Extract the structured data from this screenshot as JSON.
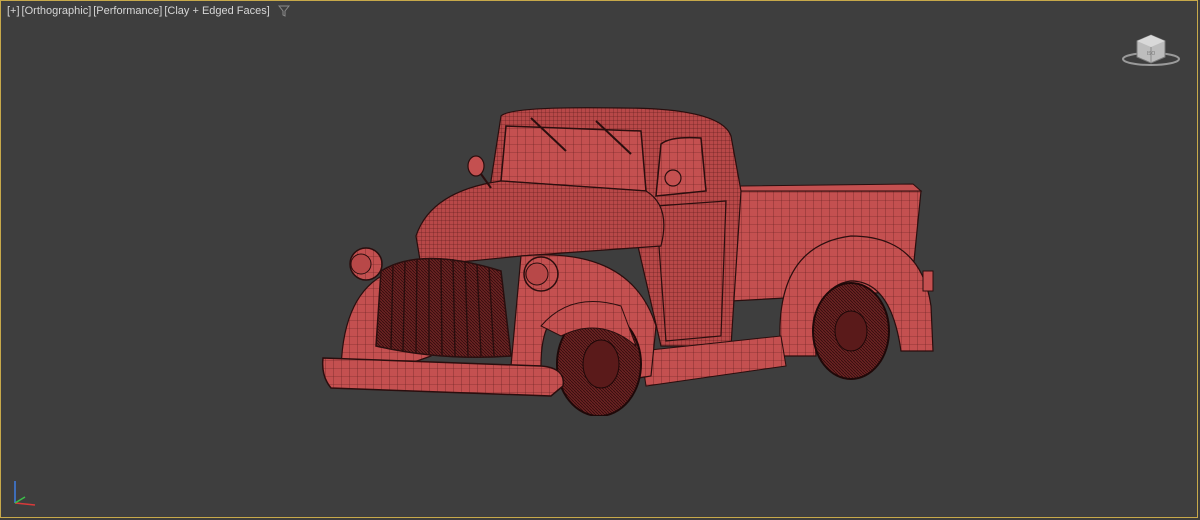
{
  "viewport": {
    "labels": [
      "[+]",
      "[Orthographic]",
      "[Performance]",
      "[Clay + Edged Faces]"
    ],
    "filter_icon": "filter-funnel-icon",
    "viewcube_icon": "viewcube-icon",
    "axis_icon": "axis-tripod-icon",
    "model_name": "pickup-truck-model",
    "colors": {
      "background": "#3e3e3e",
      "border": "#c7a94a",
      "clay": "#c45050",
      "edge": "#2a0e0e"
    }
  }
}
